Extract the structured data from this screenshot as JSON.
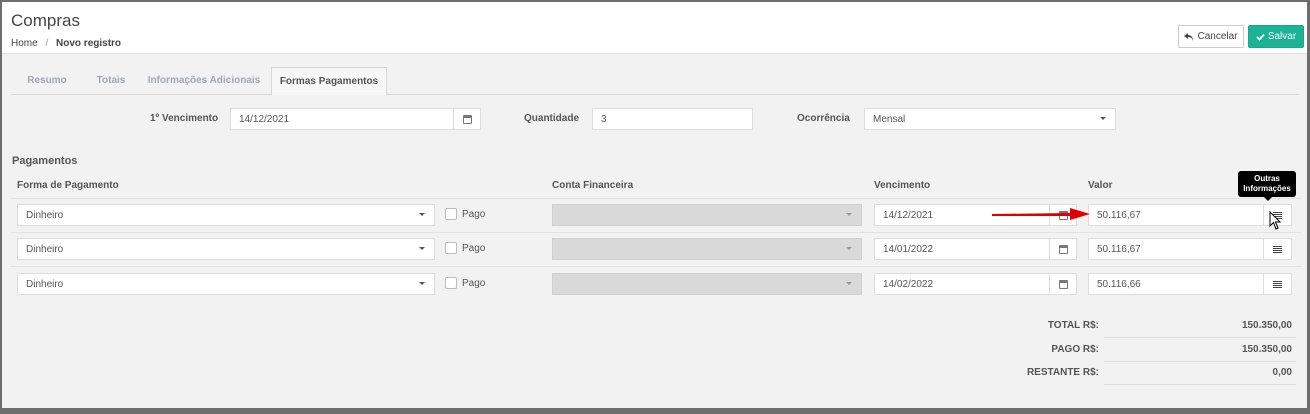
{
  "header": {
    "title": "Compras",
    "breadcrumb": {
      "home": "Home",
      "separator": "/",
      "current": "Novo registro"
    },
    "cancel_label": "Cancelar",
    "save_label": "Salvar"
  },
  "tabs": [
    {
      "label": "Resumo",
      "active": false
    },
    {
      "label": "Totais",
      "active": false
    },
    {
      "label": "Informações Adicionais",
      "active": false
    },
    {
      "label": "Formas Pagamentos",
      "active": true
    }
  ],
  "form": {
    "vencimento_label": "1º Vencimento",
    "vencimento_value": "14/12/2021",
    "quantidade_label": "Quantidade",
    "quantidade_value": "3",
    "ocorrencia_label": "Ocorrência",
    "ocorrencia_value": "Mensal"
  },
  "payments": {
    "section_title": "Pagamentos",
    "columns": {
      "forma": "Forma de Pagamento",
      "conta": "Conta Financeira",
      "vencimento": "Vencimento",
      "valor": "Valor"
    },
    "rows": [
      {
        "forma": "Dinheiro",
        "pago_label": "Pago",
        "pago": false,
        "conta": "",
        "vencimento": "14/12/2021",
        "valor": "50.116,67"
      },
      {
        "forma": "Dinheiro",
        "pago_label": "Pago",
        "pago": false,
        "conta": "",
        "vencimento": "14/01/2022",
        "valor": "50.116,67"
      },
      {
        "forma": "Dinheiro",
        "pago_label": "Pago",
        "pago": false,
        "conta": "",
        "vencimento": "14/02/2022",
        "valor": "50.116,66"
      }
    ],
    "tooltip": "Outras Informações"
  },
  "totals": {
    "total_label": "TOTAL R$:",
    "total_value": "150.350,00",
    "pago_label": "PAGO R$:",
    "pago_value": "150.350,00",
    "restante_label": "RESTANTE R$:",
    "restante_value": "0,00"
  },
  "colors": {
    "accent": "#1ab394",
    "arrow": "#e00000"
  }
}
